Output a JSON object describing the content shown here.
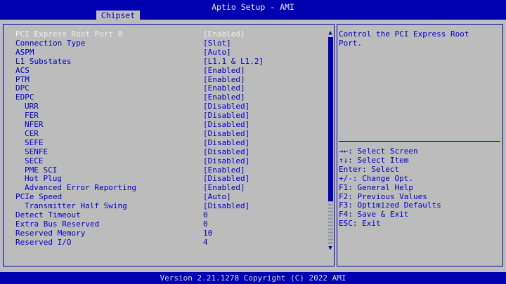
{
  "app": {
    "title": "Aptio Setup - AMI",
    "active_tab": "Chipset"
  },
  "settings": [
    {
      "label": "PCI Express Root Port 8",
      "value": "[Enabled]",
      "indent": 0
    },
    {
      "label": "Connection Type",
      "value": "[Slot]",
      "indent": 0
    },
    {
      "label": "ASPM",
      "value": "[Auto]",
      "indent": 0
    },
    {
      "label": "L1 Substates",
      "value": "[L1.1 & L1.2]",
      "indent": 0
    },
    {
      "label": "ACS",
      "value": "[Enabled]",
      "indent": 0
    },
    {
      "label": "PTM",
      "value": "[Enabled]",
      "indent": 0
    },
    {
      "label": "DPC",
      "value": "[Enabled]",
      "indent": 0
    },
    {
      "label": "EDPC",
      "value": "[Enabled]",
      "indent": 0
    },
    {
      "label": "URR",
      "value": "[Disabled]",
      "indent": 1
    },
    {
      "label": "FER",
      "value": "[Disabled]",
      "indent": 1
    },
    {
      "label": "NFER",
      "value": "[Disabled]",
      "indent": 1
    },
    {
      "label": "CER",
      "value": "[Disabled]",
      "indent": 1
    },
    {
      "label": "SEFE",
      "value": "[Disabled]",
      "indent": 1
    },
    {
      "label": "SENFE",
      "value": "[Disabled]",
      "indent": 1
    },
    {
      "label": "SECE",
      "value": "[Disabled]",
      "indent": 1
    },
    {
      "label": "PME SCI",
      "value": "[Enabled]",
      "indent": 1
    },
    {
      "label": "Hot Plug",
      "value": "[Disabled]",
      "indent": 1
    },
    {
      "label": "Advanced Error Reporting",
      "value": "[Enabled]",
      "indent": 1
    },
    {
      "label": "PCIe Speed",
      "value": "[Auto]",
      "indent": 0
    },
    {
      "label": "Transmitter Half Swing",
      "value": "[Disabled]",
      "indent": 1
    },
    {
      "label": "Detect Timeout",
      "value": "0",
      "indent": 0
    },
    {
      "label": "Extra Bus Reserved",
      "value": "0",
      "indent": 0
    },
    {
      "label": "Reserved Memory",
      "value": "10",
      "indent": 0
    },
    {
      "label": "Reserved I/O",
      "value": "4",
      "indent": 0
    }
  ],
  "help_text": "Control the PCI Express Root Port.",
  "key_help": [
    "→←: Select Screen",
    "↑↓: Select Item",
    "Enter: Select",
    "+/-: Change Opt.",
    "F1: General Help",
    "F2: Previous Values",
    "F3: Optimized Defaults",
    "F4: Save & Exit",
    "ESC: Exit"
  ],
  "footer": "Version 2.21.1278 Copyright (C) 2022 AMI",
  "icons": {
    "scroll_up": "▲",
    "scroll_down": "▼"
  },
  "colors": {
    "background_blue": "#0000b0",
    "panel_gray": "#bcbcbc",
    "text_blue": "#0000c8",
    "selected_text": "#f0f0f0"
  }
}
